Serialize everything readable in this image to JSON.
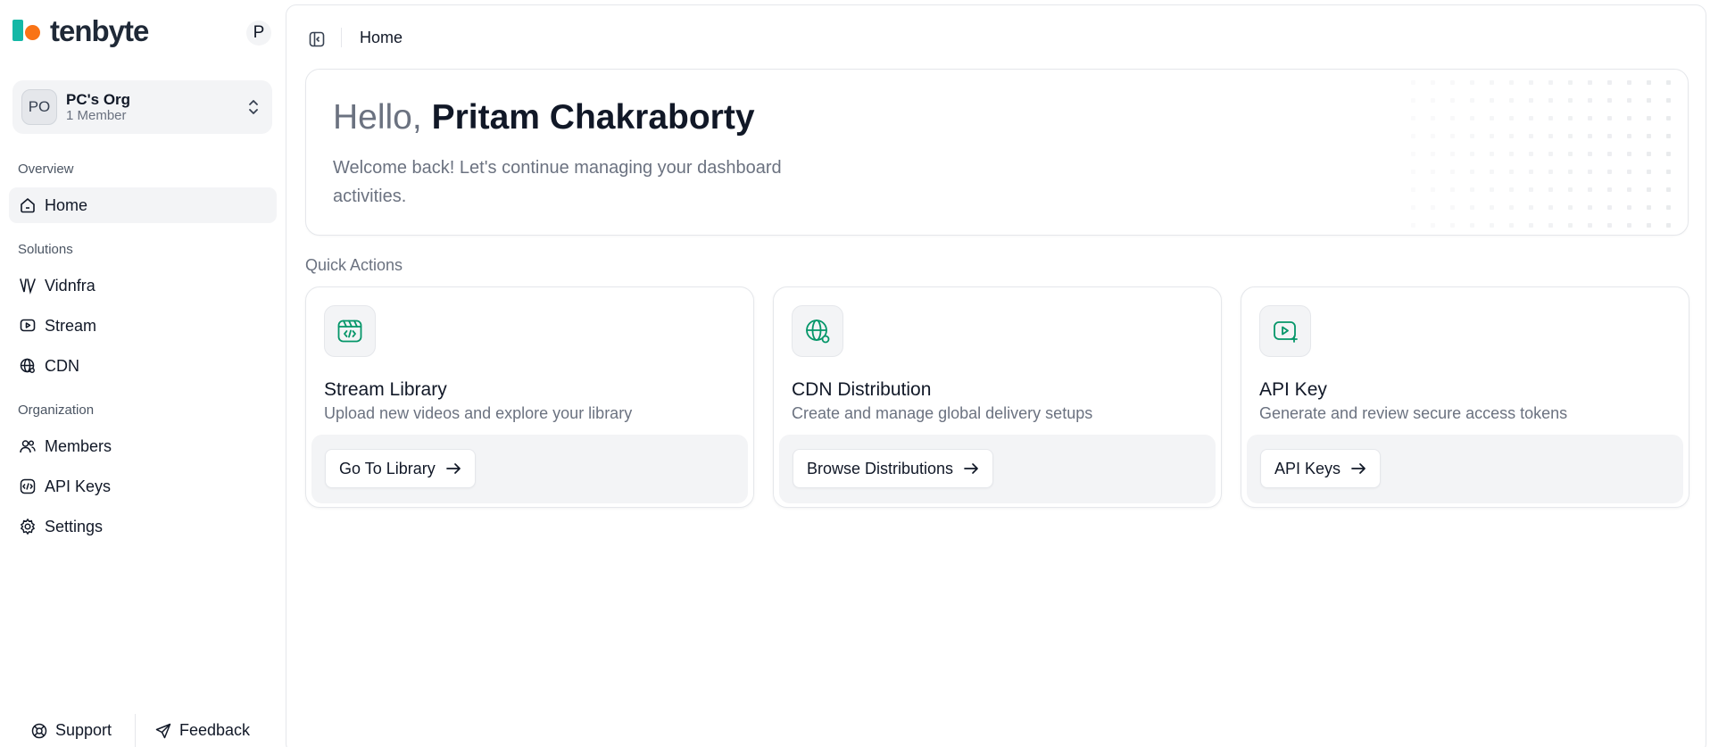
{
  "brand": {
    "name": "tenbyte"
  },
  "user": {
    "initial": "P"
  },
  "org": {
    "initials": "PO",
    "name": "PC's Org",
    "members": "1 Member"
  },
  "sidebar": {
    "sections": {
      "overview": "Overview",
      "solutions": "Solutions",
      "organization": "Organization"
    },
    "items": {
      "home": "Home",
      "vidnfra": "Vidnfra",
      "stream": "Stream",
      "cdn": "CDN",
      "members": "Members",
      "api_keys": "API Keys",
      "settings": "Settings"
    },
    "active": "home"
  },
  "footer": {
    "support": "Support",
    "feedback": "Feedback"
  },
  "topbar": {
    "breadcrumb": "Home"
  },
  "hero": {
    "greeting": "Hello,",
    "name": "Pritam Chakraborty",
    "subtitle": "Welcome back! Let's continue managing your dashboard activities."
  },
  "quick_actions": {
    "label": "Quick Actions",
    "cards": [
      {
        "icon": "stream-library-icon",
        "title": "Stream Library",
        "description": "Upload new videos and explore your library",
        "button": "Go To Library"
      },
      {
        "icon": "cdn-globe-icon",
        "title": "CDN Distribution",
        "description": "Create and manage global delivery setups",
        "button": "Browse Distributions"
      },
      {
        "icon": "api-key-play-icon",
        "title": "API Key",
        "description": "Generate and review secure access tokens",
        "button": "API Keys"
      }
    ]
  },
  "colors": {
    "brand_teal": "#14b8a6",
    "brand_orange": "#f97316",
    "icon_green": "#059669",
    "active_bg": "#f3f4f6"
  }
}
